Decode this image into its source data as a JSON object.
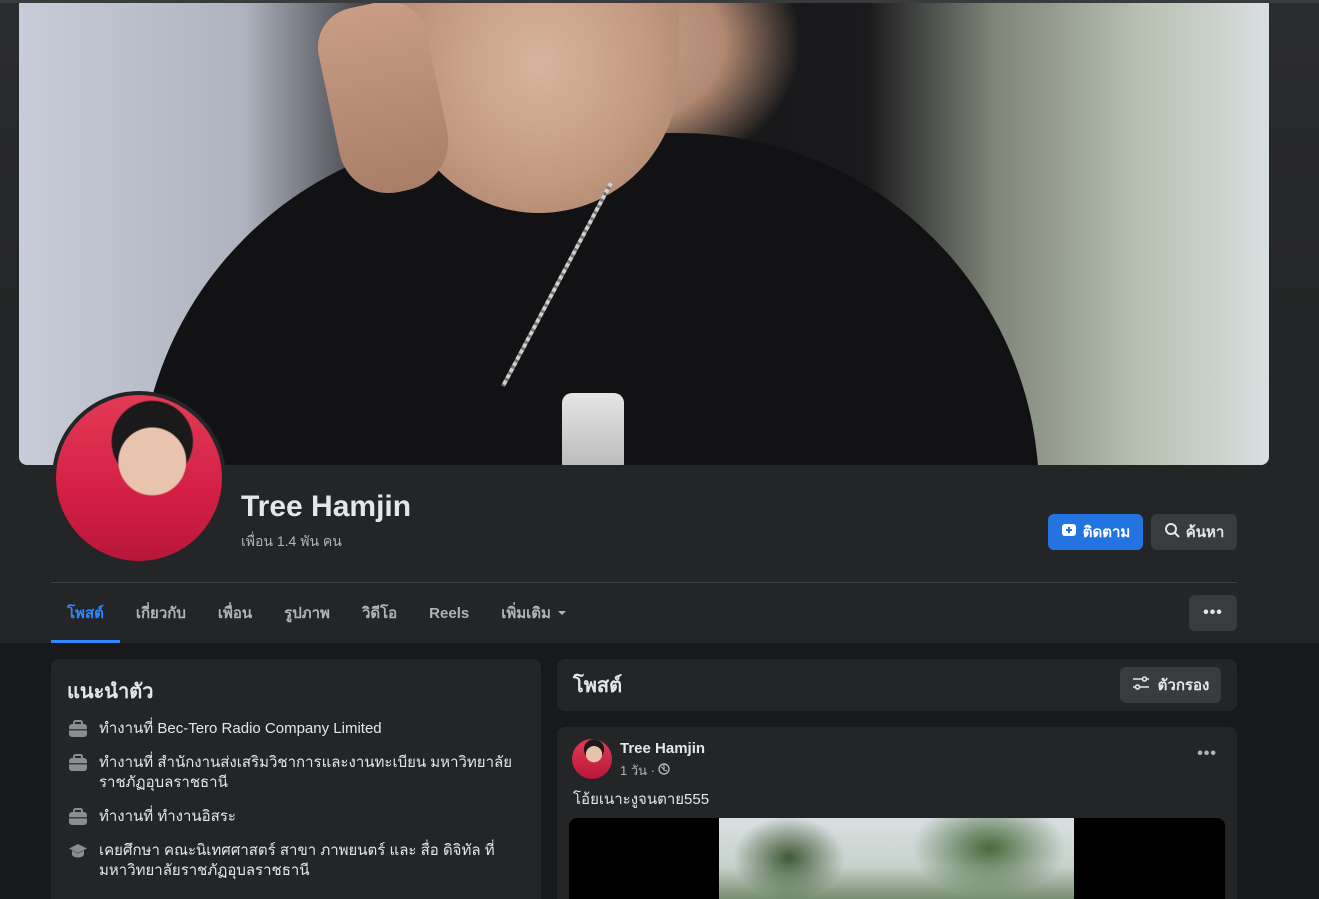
{
  "profile": {
    "name": "Tree Hamjin",
    "friends": "เพื่อน 1.4 พัน คน"
  },
  "actions": {
    "follow_label": "ติดตาม",
    "search_label": "ค้นหา"
  },
  "tabs": [
    {
      "label": "โพสต์",
      "active": true
    },
    {
      "label": "เกี่ยวกับ"
    },
    {
      "label": "เพื่อน"
    },
    {
      "label": "รูปภาพ"
    },
    {
      "label": "วิดีโอ"
    },
    {
      "label": "Reels"
    },
    {
      "label": "เพิ่มเติม"
    }
  ],
  "intro": {
    "title": "แนะนำตัว",
    "items": [
      {
        "icon": "briefcase-icon",
        "text": "ทำงานที่ Bec-Tero Radio Company Limited"
      },
      {
        "icon": "briefcase-icon",
        "text": "ทำงานที่ สำนักงานส่งเสริมวิชาการและงานทะเบียน มหาวิทยาลัยราชภัฏอุบลราชธานี"
      },
      {
        "icon": "briefcase-icon",
        "text": "ทำงานที่ ทำงานอิสระ"
      },
      {
        "icon": "graduation-cap-icon",
        "text": "เคยศึกษา คณะนิเทศศาสตร์ สาขา ภาพยนตร์ และ สื่อ ดิจิทัล ที่ มหาวิทยาลัยราชภัฏอุบลราชธานี"
      }
    ]
  },
  "posts": {
    "title": "โพสต์",
    "filter_label": "ตัวกรอง"
  },
  "post": {
    "author": "Tree Hamjin",
    "time": "1 วัน ·",
    "privacy_icon": "globe-icon",
    "text": "โอ้ยเนาะงูจนตาย555"
  },
  "colors": {
    "accent": "#2d88ff",
    "button_primary": "#2374e1",
    "surface": "#242526",
    "background": "#18191a"
  }
}
